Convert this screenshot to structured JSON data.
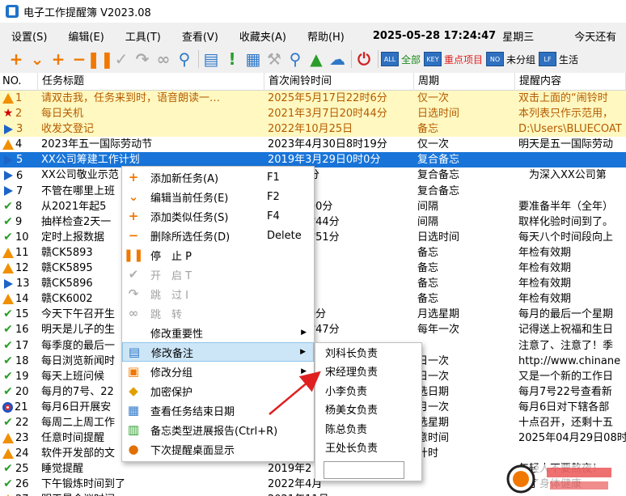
{
  "window": {
    "title": "电子工作提醒簿 V2023.08"
  },
  "menu": {
    "items": [
      "设置(S)",
      "编辑(E)",
      "工具(T)",
      "查看(V)",
      "收藏夹(A)",
      "帮助(H)"
    ],
    "datetime": "2025-05-28 17:24:47",
    "weekday": "星期三",
    "remaining": "今天还有"
  },
  "toolbar": {
    "filters": [
      "全部",
      "重点项目",
      "未分组",
      "生活"
    ]
  },
  "grid": {
    "headers": [
      "NO.",
      "任务标题",
      "首次闹铃时间",
      "周期",
      "提醒内容"
    ],
    "rows": [
      {
        "icon": "warn",
        "no": "1",
        "title": "请双击我，任务来到时，语音朗读一…",
        "time": "2025年5月17日22时6分",
        "cycle": "仅一次",
        "content": "双击上面的“闹铃时",
        "style": "yellow"
      },
      {
        "icon": "star",
        "no": "2",
        "title": "每日关机",
        "time": "2021年3月7日20时44分",
        "cycle": "日选时间",
        "content": "本列表只作示范用，",
        "style": "yellow"
      },
      {
        "icon": "play",
        "no": "3",
        "title": "收发文登记",
        "time": "2022年10月25日",
        "cycle": "备忘",
        "content": "D:\\Users\\BLUECOAT",
        "style": "yellow"
      },
      {
        "icon": "warn",
        "no": "4",
        "title": "2023年五一国际劳动节",
        "time": "2023年4月30日8时19分",
        "cycle": "仅一次",
        "content": "明天是五一国际劳动",
        "style": ""
      },
      {
        "icon": "play",
        "no": "5",
        "title": "XX公司筹建工作计划",
        "time": "2019年3月29日0时0分",
        "cycle": "复合备忘",
        "content": "",
        "style": "selected"
      },
      {
        "icon": "play",
        "no": "6",
        "title": "XX公司敬业示范",
        "time": "2日0时0分",
        "cycle": "复合备忘",
        "content": "　为深入XX公司第",
        "style": ""
      },
      {
        "icon": "play",
        "no": "7",
        "title": "不管在哪里上班",
        "time": "",
        "cycle": "复合备忘",
        "content": "",
        "style": ""
      },
      {
        "icon": "check",
        "no": "8",
        "title": "从2021年起5",
        "time": "31日9时00分",
        "cycle": "间隔",
        "content": "要准备半年（全年）",
        "style": ""
      },
      {
        "icon": "check",
        "no": "9",
        "title": "抽样检查2天一",
        "time": "28日23时44分",
        "cycle": "间隔",
        "content": "取样化验时间到了。",
        "style": ""
      },
      {
        "icon": "check",
        "no": "10",
        "title": "定时上报数据",
        "time": "25日17时51分",
        "cycle": "日选时间",
        "content": "每天八个时间段向上",
        "style": ""
      },
      {
        "icon": "warn",
        "no": "11",
        "title": "赣CK5893",
        "time": "25日",
        "cycle": "备忘",
        "content": "年检有效期",
        "style": ""
      },
      {
        "icon": "warn",
        "no": "12",
        "title": "赣CK5895",
        "time": "26日",
        "cycle": "备忘",
        "content": "年检有效期",
        "style": ""
      },
      {
        "icon": "play",
        "no": "13",
        "title": "赣CK5896",
        "time": "26日7时",
        "cycle": "备忘",
        "content": "年检有效期",
        "style": ""
      },
      {
        "icon": "warn",
        "no": "14",
        "title": "赣CK6002",
        "time": "26日",
        "cycle": "备忘",
        "content": "年检有效期",
        "style": ""
      },
      {
        "icon": "check",
        "no": "15",
        "title": "今天下午召开生",
        "time": "28日9时0分",
        "cycle": "月选星期",
        "content": "每月的最后一个星期",
        "style": ""
      },
      {
        "icon": "check",
        "no": "16",
        "title": "明天是儿子的生",
        "time": "16日15时47分",
        "cycle": "每年一次",
        "content": "记得送上祝福和生日",
        "style": ""
      },
      {
        "icon": "check",
        "no": "17",
        "title": "每季度的最后一",
        "time": "",
        "cycle": "",
        "content": "注意了、注意了！季",
        "style": ""
      },
      {
        "icon": "check",
        "no": "18",
        "title": "每日浏览新闻时",
        "time": "",
        "cycle": "日一次",
        "content": "http://www.chinane",
        "style": ""
      },
      {
        "icon": "check",
        "no": "19",
        "title": "每天上班问候",
        "time": "",
        "cycle": "日一次",
        "content": "又是一个新的工作日",
        "style": ""
      },
      {
        "icon": "check",
        "no": "20",
        "title": "每月的7号、22",
        "time": "",
        "cycle": "选日期",
        "content": "每月7号22号查看新",
        "style": ""
      },
      {
        "icon": "clock",
        "no": "21",
        "title": "每月6日开展安",
        "time": "",
        "cycle": "月一次",
        "content": "每月6日对下辖各部",
        "style": ""
      },
      {
        "icon": "check",
        "no": "22",
        "title": "每周二上周工作",
        "time": "",
        "cycle": "选星期",
        "content": "十点召开，还剩十五",
        "style": ""
      },
      {
        "icon": "warn",
        "no": "23",
        "title": "任意时间提醒",
        "time": "",
        "cycle": "意时间",
        "content": "2025年04月29日08时",
        "style": ""
      },
      {
        "icon": "warn",
        "no": "24",
        "title": "软件开发部的文",
        "time": "",
        "cycle": "计时",
        "content": "",
        "style": ""
      },
      {
        "icon": "check",
        "no": "25",
        "title": "睡觉提醒",
        "time": "2019年2",
        "cycle": "",
        "content": "年轻人不要熬夜！",
        "style": ""
      },
      {
        "icon": "check",
        "no": "26",
        "title": "下午锻炼时间到了",
        "time": "2022年4月",
        "cycle": "",
        "content": "为了身体健康",
        "style": ""
      },
      {
        "icon": "warn",
        "no": "27",
        "title": "明天是会议时间",
        "time": "2021年11月",
        "cycle": "",
        "content": "",
        "style": ""
      }
    ]
  },
  "context_menu": {
    "items": [
      {
        "icon": "plus",
        "label": "添加新任务(A)",
        "shortcut": "F1",
        "disabled": false,
        "submenu": false
      },
      {
        "icon": "edit",
        "label": "编辑当前任务(E)",
        "shortcut": "F2",
        "disabled": false,
        "submenu": false
      },
      {
        "icon": "plus-small",
        "label": "添加类似任务(S)",
        "shortcut": "F4",
        "disabled": false,
        "submenu": false
      },
      {
        "icon": "minus",
        "label": "删除所选任务(D)",
        "shortcut": "Delete",
        "disabled": false,
        "submenu": false
      },
      {
        "icon": "pause",
        "label": "停　止 P",
        "shortcut": "",
        "disabled": false,
        "submenu": false
      },
      {
        "icon": "check",
        "label": "开　启 T",
        "shortcut": "",
        "disabled": true,
        "submenu": false
      },
      {
        "icon": "skip",
        "label": "跳　过 I",
        "shortcut": "",
        "disabled": true,
        "submenu": false
      },
      {
        "icon": "link",
        "label": "跳　转",
        "shortcut": "",
        "disabled": true,
        "submenu": false
      },
      {
        "icon": "",
        "label": "修改重要性",
        "shortcut": "",
        "disabled": false,
        "submenu": true
      },
      {
        "icon": "note",
        "label": "修改备注",
        "shortcut": "",
        "disabled": false,
        "submenu": true
      },
      {
        "icon": "group",
        "label": "修改分组",
        "shortcut": "",
        "disabled": false,
        "submenu": true
      },
      {
        "icon": "lock",
        "label": "加密保护",
        "shortcut": "",
        "disabled": false,
        "submenu": false
      },
      {
        "icon": "calendar",
        "label": "查看任务结束日期",
        "shortcut": "",
        "disabled": false,
        "submenu": false
      },
      {
        "icon": "report",
        "label": "备忘类型进展报告(Ctrl+R)",
        "shortcut": "",
        "disabled": false,
        "submenu": false
      },
      {
        "icon": "desktop",
        "label": "下次提醒桌面显示",
        "shortcut": "",
        "disabled": false,
        "submenu": false
      }
    ]
  },
  "submenu": {
    "items": [
      "刘科长负责",
      "宋经理负责",
      "小李负责",
      "杨美女负责",
      "陈总负责",
      "王处长负责"
    ],
    "input_value": ""
  }
}
